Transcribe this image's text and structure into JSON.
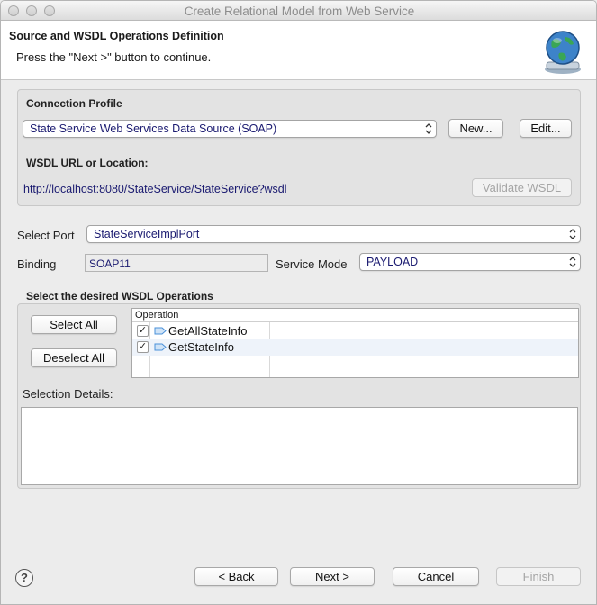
{
  "window": {
    "title": "Create Relational Model from Web Service"
  },
  "header": {
    "title": "Source and WSDL Operations Definition",
    "subtitle": "Press the \"Next >\" button to continue.",
    "icon": "globe-icon"
  },
  "connection": {
    "label": "Connection Profile",
    "selected": "State Service Web Services Data Source (SOAP)",
    "new_label": "New...",
    "edit_label": "Edit..."
  },
  "wsdl": {
    "label": "WSDL URL or Location:",
    "url": "http://localhost:8080/StateService/StateService?wsdl",
    "validate_label": "Validate WSDL"
  },
  "port": {
    "label": "Select Port",
    "selected": "StateServiceImplPort"
  },
  "binding": {
    "label": "Binding",
    "value": "SOAP11"
  },
  "service_mode": {
    "label": "Service Mode",
    "selected": "PAYLOAD"
  },
  "operations": {
    "label": "Select the desired WSDL Operations",
    "select_all_label": "Select All",
    "deselect_all_label": "Deselect All",
    "column_header": "Operation",
    "rows": [
      {
        "name": "GetAllStateInfo",
        "checked": true
      },
      {
        "name": "GetStateInfo",
        "checked": true
      }
    ]
  },
  "selection_details": {
    "label": "Selection Details:",
    "content": ""
  },
  "footer": {
    "help_label": "?",
    "back_label": "< Back",
    "next_label": "Next >",
    "cancel_label": "Cancel",
    "finish_label": "Finish"
  },
  "colors": {
    "link_text": "#1a1a70",
    "row_alt": "#eef3fa",
    "icon_blue": "#4a90d9"
  }
}
